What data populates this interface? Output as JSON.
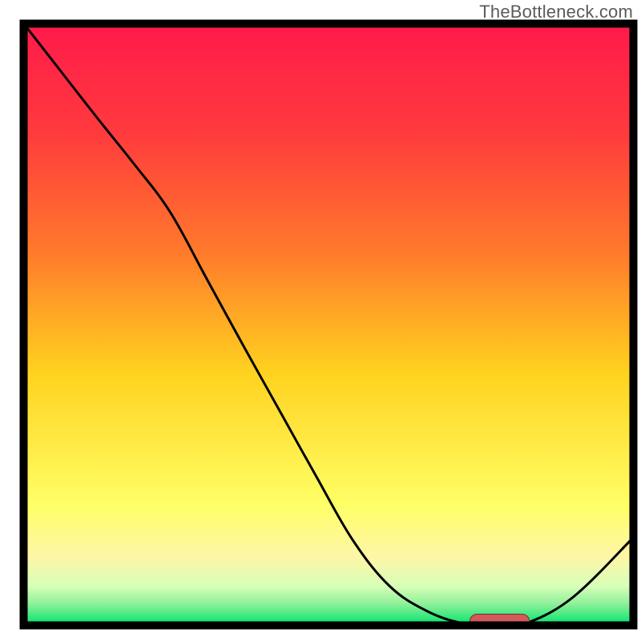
{
  "attribution": "TheBottleneck.com",
  "chart_data": {
    "type": "line",
    "x": [
      0.0,
      0.06,
      0.12,
      0.18,
      0.24,
      0.3,
      0.36,
      0.42,
      0.48,
      0.54,
      0.6,
      0.66,
      0.72,
      0.78,
      0.82,
      0.9,
      1.0
    ],
    "values": [
      1.0,
      0.922,
      0.844,
      0.768,
      0.687,
      0.576,
      0.465,
      0.356,
      0.247,
      0.141,
      0.065,
      0.024,
      0.003,
      0.0,
      0.001,
      0.045,
      0.145
    ],
    "title": "",
    "xlabel": "",
    "ylabel": "",
    "xlim": [
      0,
      1
    ],
    "ylim": [
      0,
      1
    ],
    "marker": {
      "x_start": 0.732,
      "x_end": 0.83,
      "y": 0.006
    }
  },
  "colors": {
    "grad_top": "#ff1a4b",
    "grad_mid_upper": "#ff7a2b",
    "grad_mid": "#ffd21f",
    "grad_lower": "#fff6a6",
    "grad_pale": "#d8ffb8",
    "grad_bottom": "#00e36b",
    "curve": "#000000",
    "border": "#000000",
    "marker_fill": "#d25a5a",
    "marker_edge": "#7a2d2d"
  }
}
